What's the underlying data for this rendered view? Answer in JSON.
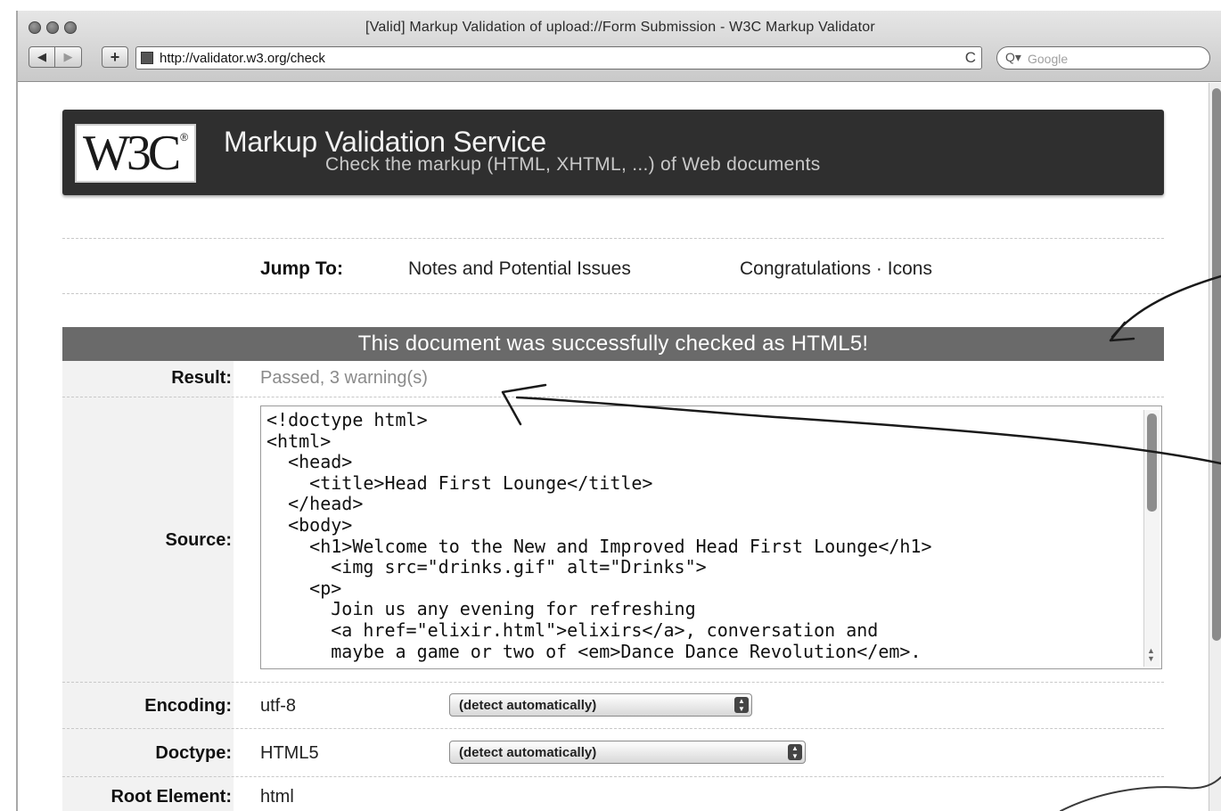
{
  "window": {
    "title": "[Valid] Markup Validation of upload://Form Submission - W3C Markup Validator"
  },
  "toolbar": {
    "back_icon": "◀",
    "forward_icon": "▶",
    "add_icon": "+",
    "url": "http://validator.w3.org/check",
    "reload_icon": "C",
    "search_icon": "Q▾",
    "search_placeholder": "Google"
  },
  "banner": {
    "logo_text": "W3C",
    "logo_reg": "®",
    "title": "Markup Validation Service",
    "subtitle": "Check the markup (HTML, XHTML, ...) of Web documents"
  },
  "jump": {
    "label": "Jump To:",
    "links": [
      "Notes and Potential Issues",
      "Congratulations · Icons"
    ]
  },
  "status": {
    "message": "This document was successfully checked as HTML5!"
  },
  "result": {
    "label": "Result:",
    "value": "Passed, 3 warning(s)"
  },
  "source": {
    "label": "Source:",
    "code": "<!doctype html>\n<html>\n  <head>\n    <title>Head First Lounge</title>\n  </head>\n  <body>\n    <h1>Welcome to the New and Improved Head First Lounge</h1>\n      <img src=\"drinks.gif\" alt=\"Drinks\">\n    <p>\n      Join us any evening for refreshing\n      <a href=\"elixir.html\">elixirs</a>, conversation and\n      maybe a game or two of <em>Dance Dance Revolution</em>."
  },
  "encoding": {
    "label": "Encoding:",
    "value": "utf-8",
    "select": "(detect automatically)"
  },
  "doctype": {
    "label": "Doctype:",
    "value": "HTML5",
    "select": "(detect automatically)"
  },
  "root_element": {
    "label": "Root Element:",
    "value": "html"
  },
  "colors": {
    "banner": "#2f2f2f",
    "success_bar": "#6a6a6a",
    "label_column": "#f2f2f2"
  }
}
